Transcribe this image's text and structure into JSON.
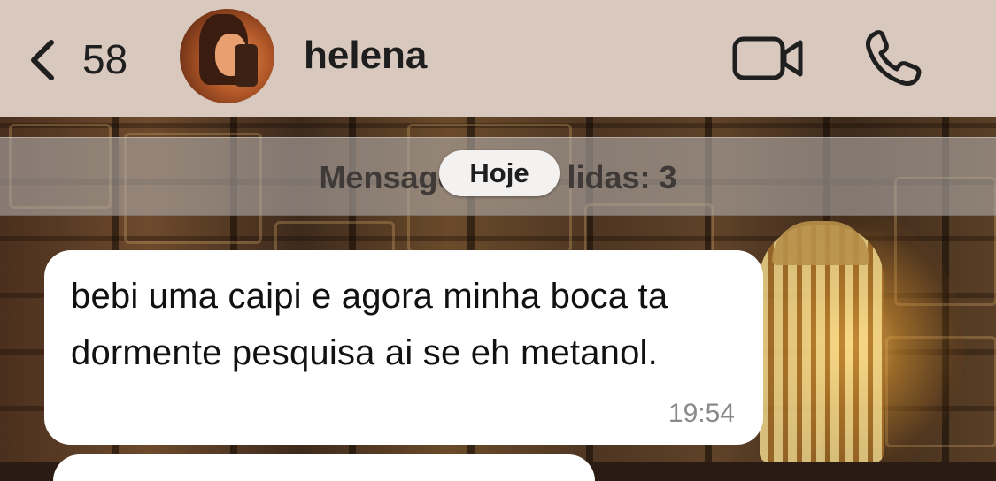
{
  "header": {
    "back_count": "58",
    "contact_name": "helena",
    "icons": {
      "back": "chevron-left-icon",
      "video": "video-camera-icon",
      "call": "phone-icon"
    }
  },
  "chat": {
    "unread_banner": "Mensagens não lidas: 3",
    "date_pill": "Hoje",
    "messages": [
      {
        "text": "bebi uma caipi e agora minha boca ta dormente pesquisa ai se eh metanol.",
        "time": "19:54",
        "direction": "incoming"
      }
    ]
  },
  "colors": {
    "header_bg": "#d8c8be",
    "bubble_incoming": "#ffffff",
    "text_primary": "#1e1e1e",
    "time_text": "#8a8a8a"
  }
}
